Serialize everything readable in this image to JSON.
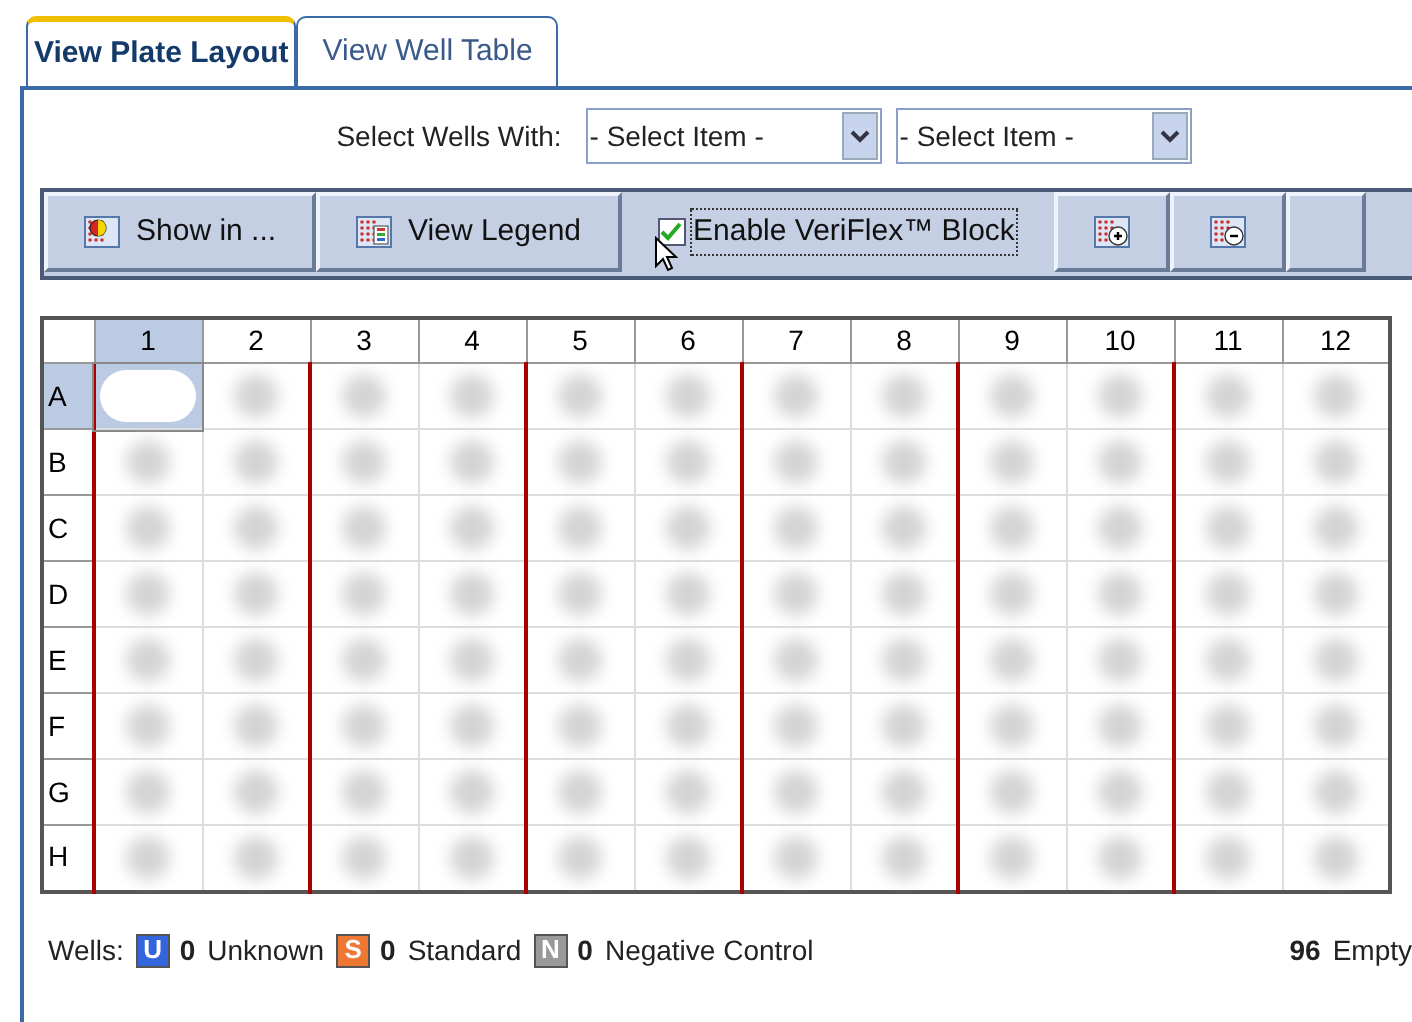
{
  "tabs": [
    {
      "label": "View Plate Layout",
      "selected": true
    },
    {
      "label": "View Well Table",
      "selected": false
    }
  ],
  "select_wells": {
    "label": "Select Wells With:",
    "dropdowns": [
      {
        "value": "- Select Item -"
      },
      {
        "value": "- Select Item -"
      }
    ]
  },
  "toolbar": [
    {
      "kind": "button",
      "label": "Show in ..."
    },
    {
      "kind": "button",
      "label": "View Legend"
    },
    {
      "kind": "checkbox",
      "label": "Enable VeriFlex™ Block",
      "checked": true
    },
    {
      "kind": "zoom-in"
    },
    {
      "kind": "zoom-out"
    },
    {
      "kind": "partial"
    }
  ],
  "plate": {
    "columns": [
      {
        "label": "1",
        "selected": true
      },
      {
        "label": "2",
        "selected": false
      },
      {
        "label": "3",
        "selected": false
      },
      {
        "label": "4",
        "selected": false
      },
      {
        "label": "5",
        "selected": false
      },
      {
        "label": "6",
        "selected": false
      },
      {
        "label": "7",
        "selected": false
      },
      {
        "label": "8",
        "selected": false
      },
      {
        "label": "9",
        "selected": false
      },
      {
        "label": "10",
        "selected": false
      },
      {
        "label": "11",
        "selected": false
      },
      {
        "label": "12",
        "selected": false
      }
    ],
    "rows": [
      {
        "label": "A",
        "selected": true,
        "wells": [
          {
            "selected": true
          },
          {
            "selected": false
          },
          {
            "selected": false
          },
          {
            "selected": false
          },
          {
            "selected": false
          },
          {
            "selected": false
          },
          {
            "selected": false
          },
          {
            "selected": false
          },
          {
            "selected": false
          },
          {
            "selected": false
          },
          {
            "selected": false
          },
          {
            "selected": false
          }
        ]
      },
      {
        "label": "B",
        "selected": false,
        "wells": [
          {
            "selected": false
          },
          {
            "selected": false
          },
          {
            "selected": false
          },
          {
            "selected": false
          },
          {
            "selected": false
          },
          {
            "selected": false
          },
          {
            "selected": false
          },
          {
            "selected": false
          },
          {
            "selected": false
          },
          {
            "selected": false
          },
          {
            "selected": false
          },
          {
            "selected": false
          }
        ]
      },
      {
        "label": "C",
        "selected": false,
        "wells": [
          {
            "selected": false
          },
          {
            "selected": false
          },
          {
            "selected": false
          },
          {
            "selected": false
          },
          {
            "selected": false
          },
          {
            "selected": false
          },
          {
            "selected": false
          },
          {
            "selected": false
          },
          {
            "selected": false
          },
          {
            "selected": false
          },
          {
            "selected": false
          },
          {
            "selected": false
          }
        ]
      },
      {
        "label": "D",
        "selected": false,
        "wells": [
          {
            "selected": false
          },
          {
            "selected": false
          },
          {
            "selected": false
          },
          {
            "selected": false
          },
          {
            "selected": false
          },
          {
            "selected": false
          },
          {
            "selected": false
          },
          {
            "selected": false
          },
          {
            "selected": false
          },
          {
            "selected": false
          },
          {
            "selected": false
          },
          {
            "selected": false
          }
        ]
      },
      {
        "label": "E",
        "selected": false,
        "wells": [
          {
            "selected": false
          },
          {
            "selected": false
          },
          {
            "selected": false
          },
          {
            "selected": false
          },
          {
            "selected": false
          },
          {
            "selected": false
          },
          {
            "selected": false
          },
          {
            "selected": false
          },
          {
            "selected": false
          },
          {
            "selected": false
          },
          {
            "selected": false
          },
          {
            "selected": false
          }
        ]
      },
      {
        "label": "F",
        "selected": false,
        "wells": [
          {
            "selected": false
          },
          {
            "selected": false
          },
          {
            "selected": false
          },
          {
            "selected": false
          },
          {
            "selected": false
          },
          {
            "selected": false
          },
          {
            "selected": false
          },
          {
            "selected": false
          },
          {
            "selected": false
          },
          {
            "selected": false
          },
          {
            "selected": false
          },
          {
            "selected": false
          }
        ]
      },
      {
        "label": "G",
        "selected": false,
        "wells": [
          {
            "selected": false
          },
          {
            "selected": false
          },
          {
            "selected": false
          },
          {
            "selected": false
          },
          {
            "selected": false
          },
          {
            "selected": false
          },
          {
            "selected": false
          },
          {
            "selected": false
          },
          {
            "selected": false
          },
          {
            "selected": false
          },
          {
            "selected": false
          },
          {
            "selected": false
          }
        ]
      },
      {
        "label": "H",
        "selected": false,
        "wells": [
          {
            "selected": false
          },
          {
            "selected": false
          },
          {
            "selected": false
          },
          {
            "selected": false
          },
          {
            "selected": false
          },
          {
            "selected": false
          },
          {
            "selected": false
          },
          {
            "selected": false
          },
          {
            "selected": false
          },
          {
            "selected": false
          },
          {
            "selected": false
          },
          {
            "selected": false
          }
        ]
      }
    ]
  },
  "legend": {
    "label": "Wells:",
    "items": [
      {
        "badge": "U",
        "color": "#3366dd",
        "count": "0",
        "label": "Unknown"
      },
      {
        "badge": "S",
        "color": "#ee7733",
        "count": "0",
        "label": "Standard"
      },
      {
        "badge": "N",
        "color": "#999999",
        "count": "0",
        "label": "Negative Control"
      }
    ],
    "empty": {
      "count": "96",
      "label": "Empty"
    }
  }
}
